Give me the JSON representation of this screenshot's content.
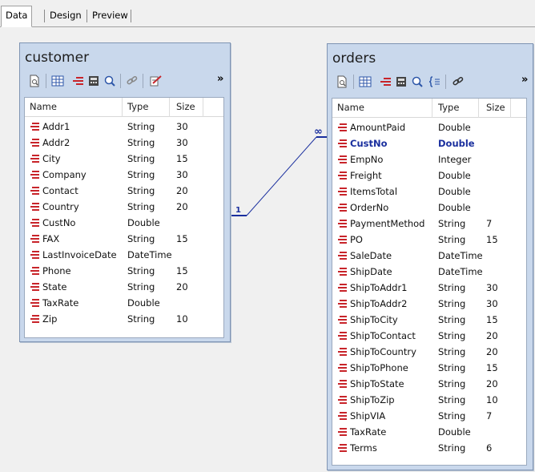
{
  "tabs": [
    {
      "label": "Data",
      "active": true
    },
    {
      "label": "Design",
      "active": false
    },
    {
      "label": "Preview",
      "active": false
    }
  ],
  "columns": {
    "name": "Name",
    "type": "Type",
    "size": "Size"
  },
  "toolbar_icons": [
    "new-icon",
    "grid-icon",
    "fields-icon",
    "calculator-icon",
    "search-icon",
    "link-icon",
    "edit-icon"
  ],
  "toolbar_more": "»",
  "tables": {
    "customer": {
      "title": "customer",
      "fields": [
        {
          "name": "Addr1",
          "type": "String",
          "size": "30"
        },
        {
          "name": "Addr2",
          "type": "String",
          "size": "30"
        },
        {
          "name": "City",
          "type": "String",
          "size": "15"
        },
        {
          "name": "Company",
          "type": "String",
          "size": "30"
        },
        {
          "name": "Contact",
          "type": "String",
          "size": "20"
        },
        {
          "name": "Country",
          "type": "String",
          "size": "20"
        },
        {
          "name": "CustNo",
          "type": "Double",
          "size": ""
        },
        {
          "name": "FAX",
          "type": "String",
          "size": "15"
        },
        {
          "name": "LastInvoiceDate",
          "type": "DateTime",
          "size": ""
        },
        {
          "name": "Phone",
          "type": "String",
          "size": "15"
        },
        {
          "name": "State",
          "type": "String",
          "size": "20"
        },
        {
          "name": "TaxRate",
          "type": "Double",
          "size": ""
        },
        {
          "name": "Zip",
          "type": "String",
          "size": "10"
        }
      ]
    },
    "orders": {
      "title": "orders",
      "fields": [
        {
          "name": "AmountPaid",
          "type": "Double",
          "size": ""
        },
        {
          "name": "CustNo",
          "type": "Double",
          "size": "",
          "key": true
        },
        {
          "name": "EmpNo",
          "type": "Integer",
          "size": ""
        },
        {
          "name": "Freight",
          "type": "Double",
          "size": ""
        },
        {
          "name": "ItemsTotal",
          "type": "Double",
          "size": ""
        },
        {
          "name": "OrderNo",
          "type": "Double",
          "size": ""
        },
        {
          "name": "PaymentMethod",
          "type": "String",
          "size": "7"
        },
        {
          "name": "PO",
          "type": "String",
          "size": "15"
        },
        {
          "name": "SaleDate",
          "type": "DateTime",
          "size": ""
        },
        {
          "name": "ShipDate",
          "type": "DateTime",
          "size": ""
        },
        {
          "name": "ShipToAddr1",
          "type": "String",
          "size": "30"
        },
        {
          "name": "ShipToAddr2",
          "type": "String",
          "size": "30"
        },
        {
          "name": "ShipToCity",
          "type": "String",
          "size": "15"
        },
        {
          "name": "ShipToContact",
          "type": "String",
          "size": "20"
        },
        {
          "name": "ShipToCountry",
          "type": "String",
          "size": "20"
        },
        {
          "name": "ShipToPhone",
          "type": "String",
          "size": "15"
        },
        {
          "name": "ShipToState",
          "type": "String",
          "size": "20"
        },
        {
          "name": "ShipToZip",
          "type": "String",
          "size": "10"
        },
        {
          "name": "ShipVIA",
          "type": "String",
          "size": "7"
        },
        {
          "name": "TaxRate",
          "type": "Double",
          "size": ""
        },
        {
          "name": "Terms",
          "type": "String",
          "size": "6"
        }
      ]
    }
  },
  "relation": {
    "one_label": "1",
    "many_label": "∞"
  },
  "colors": {
    "link": "#1a2f9e",
    "field_icon": "#c8242a",
    "window_bg": "#c9d8ec"
  }
}
